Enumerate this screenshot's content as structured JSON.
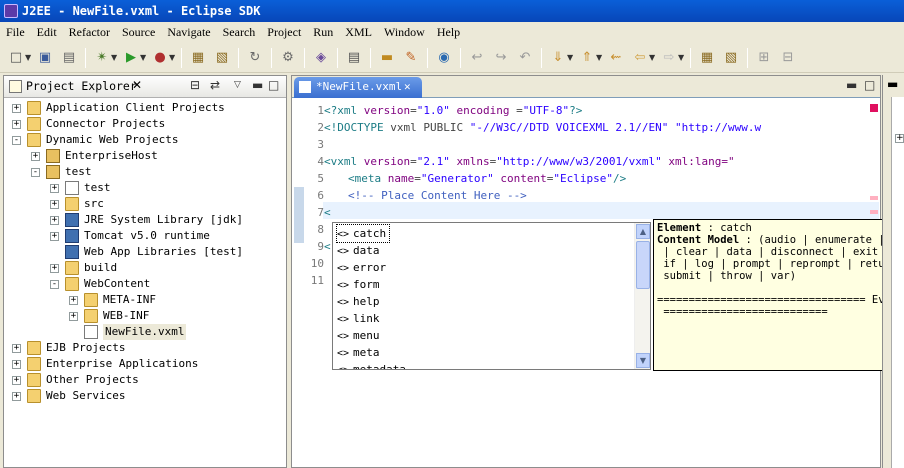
{
  "window": {
    "title": "J2EE - NewFile.vxml - Eclipse SDK"
  },
  "menubar": {
    "items": [
      "File",
      "Edit",
      "Refactor",
      "Source",
      "Navigate",
      "Search",
      "Project",
      "Run",
      "XML",
      "Window",
      "Help"
    ]
  },
  "explorer": {
    "title": "Project Explorer",
    "rows": [
      {
        "label": "Application Client Projects",
        "exp": "+"
      },
      {
        "label": "Connector Projects",
        "exp": "+"
      },
      {
        "label": "Dynamic Web Projects",
        "exp": "-"
      },
      {
        "label": "EnterpriseHost",
        "exp": "+"
      },
      {
        "label": "test",
        "exp": "-"
      },
      {
        "label": "test",
        "exp": "+"
      },
      {
        "label": "src",
        "exp": "+"
      },
      {
        "label": "JRE System Library [jdk]",
        "exp": "+"
      },
      {
        "label": "Tomcat v5.0 runtime",
        "exp": "+"
      },
      {
        "label": "Web App Libraries [test]",
        "exp": ""
      },
      {
        "label": "build",
        "exp": "+"
      },
      {
        "label": "WebContent",
        "exp": "-"
      },
      {
        "label": "META-INF",
        "exp": "+"
      },
      {
        "label": "WEB-INF",
        "exp": "+"
      },
      {
        "label": "NewFile.vxml",
        "exp": ""
      },
      {
        "label": "EJB Projects",
        "exp": "+"
      },
      {
        "label": "Enterprise Applications",
        "exp": "+"
      },
      {
        "label": "Other Projects",
        "exp": "+"
      },
      {
        "label": "Web Services",
        "exp": "+"
      }
    ]
  },
  "editor": {
    "tab_label": "*NewFile.vxml",
    "line_numbers": [
      "1",
      "2",
      "3",
      "4",
      "5",
      "6",
      "7",
      "8",
      "9",
      "10",
      "11"
    ],
    "lines": {
      "l1a": "<?xml ",
      "l1b": "version",
      "l1c": "=",
      "l1d": "\"1.0\"",
      "l1e": " encoding ",
      "l1f": "=",
      "l1g": "\"UTF-8\"",
      "l1h": "?>",
      "l2a": "<!DOCTYPE ",
      "l2b": "vxml PUBLIC ",
      "l2c": "\"-//W3C//DTD VOICEXML 2.1//EN\"",
      "l2d": " \"http://www.w",
      "l4a": "<vxml ",
      "l4b": "version",
      "l4c": "=",
      "l4d": "\"2.1\"",
      "l4e": " xmlns",
      "l4f": "=",
      "l4g": "\"http://www/w3/2001/vxml\"",
      "l4h": " xml:lang=\"",
      "l5a": "<meta ",
      "l5b": "name",
      "l5c": "=",
      "l5d": "\"Generator\"",
      "l5e": " content",
      "l5f": "=",
      "l5g": "\"Eclipse\"",
      "l5h": "/>",
      "l6": "<!-- Place Content Here -->",
      "l7": "<",
      "l9": "<"
    }
  },
  "completion": {
    "items": [
      "catch",
      "data",
      "error",
      "form",
      "help",
      "link",
      "menu",
      "meta",
      "metadata"
    ],
    "tag_glyph": "<>"
  },
  "doc": {
    "l1a": "Element",
    "l1b": " : catch",
    "l2a": "Content Model",
    "l2b": " : (audio | enumerate | va",
    "l3": " | clear | data | disconnect | exit | fore",
    "l4": " if | log | prompt | reprompt | return",
    "l5": " submit | throw | var)",
    "l6": "================================= Events",
    "l7": " =========================="
  },
  "icons": {
    "close": "close-icon",
    "minimize": "minimize-icon",
    "maximize": "maximize-icon"
  }
}
